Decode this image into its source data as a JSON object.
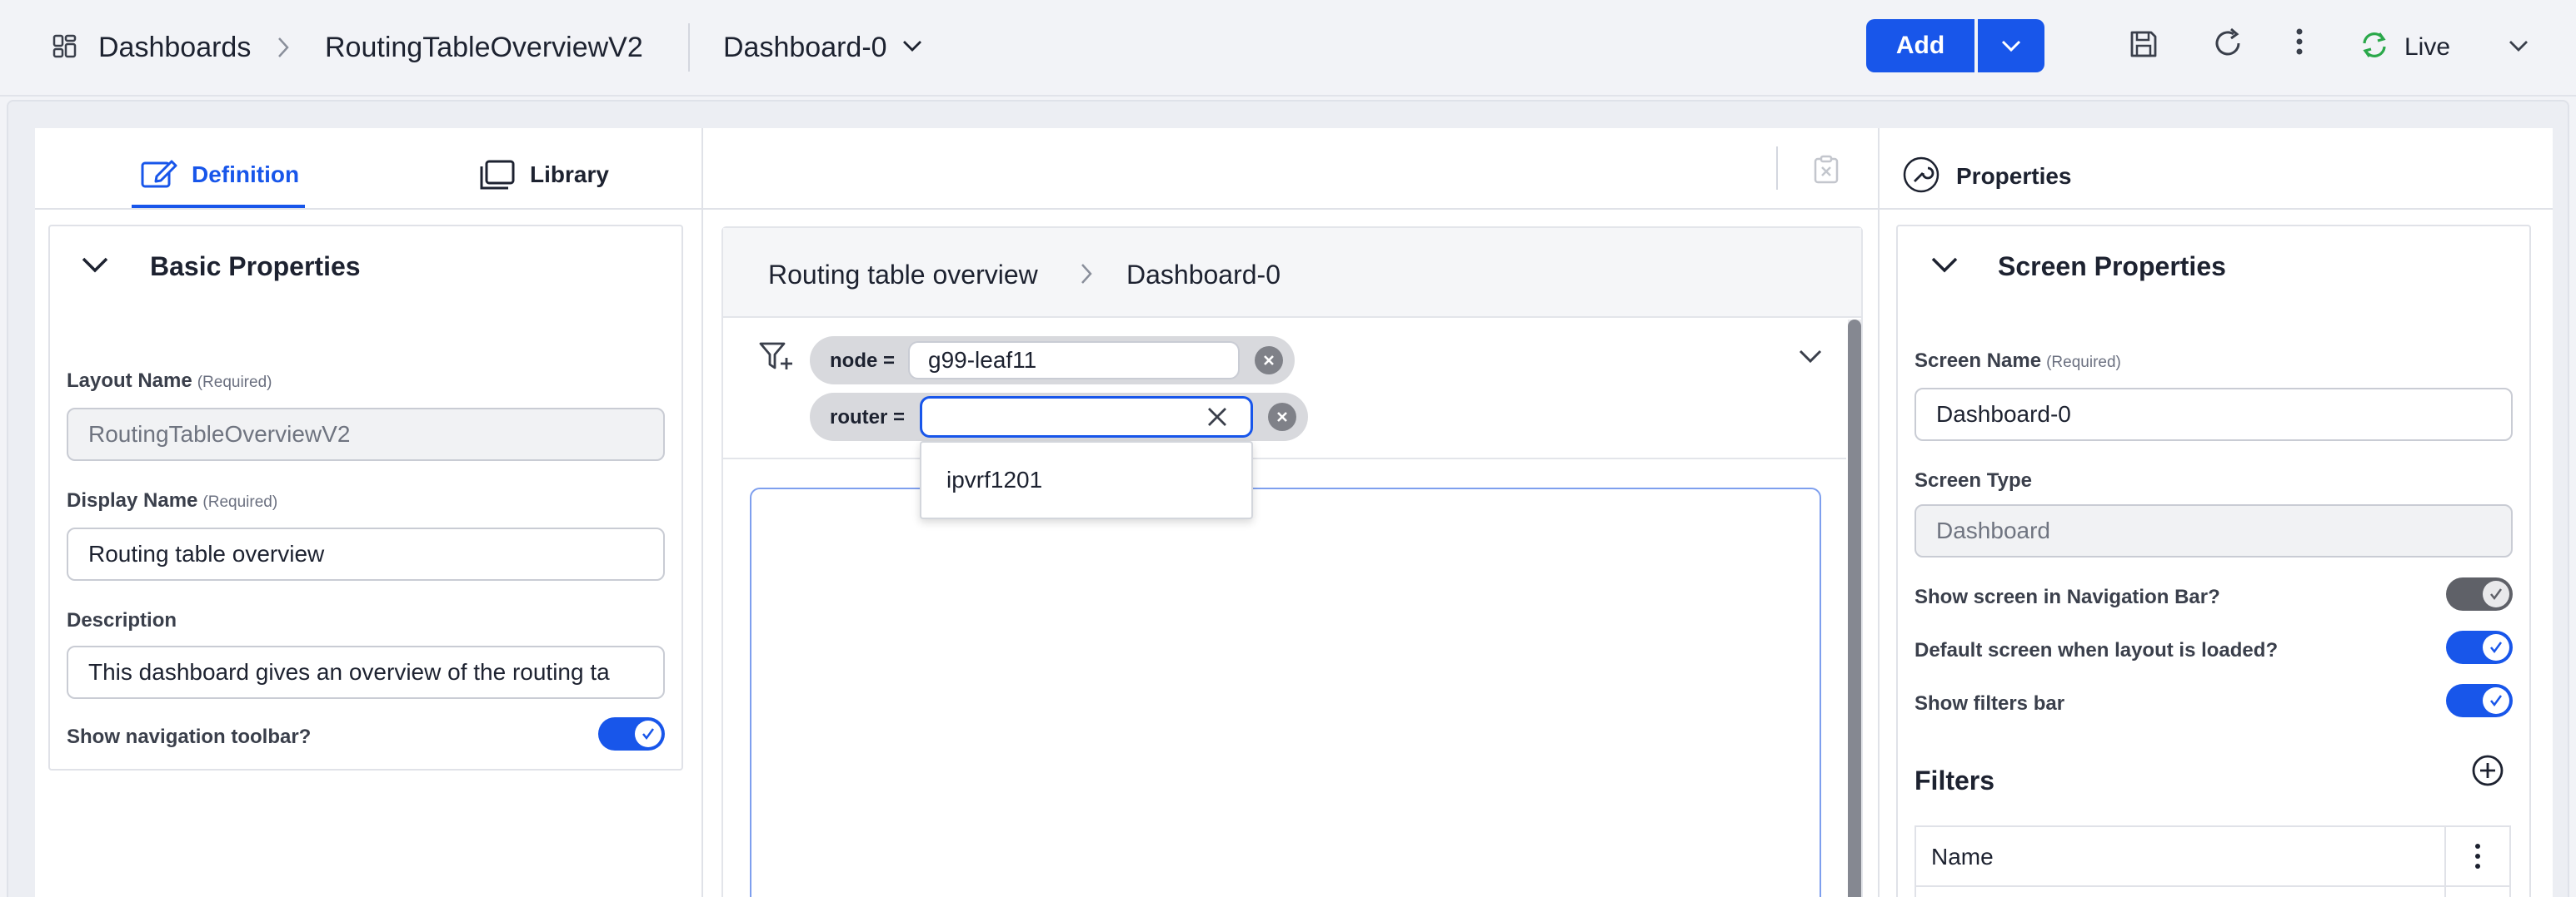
{
  "topbar": {
    "breadcrumb_root": "Dashboards",
    "breadcrumb_layout": "RoutingTableOverviewV2",
    "dashboard_selector": "Dashboard-0",
    "add_label": "Add",
    "live_label": "Live"
  },
  "left": {
    "tab_definition": "Definition",
    "tab_library": "Library",
    "section_title": "Basic Properties",
    "layout_name_label": "Layout Name",
    "layout_name_req": "(Required)",
    "layout_name_value": "RoutingTableOverviewV2",
    "display_name_label": "Display Name",
    "display_name_req": "(Required)",
    "display_name_value": "Routing table overview",
    "description_label": "Description",
    "description_value": "This dashboard gives an overview of the routing ta",
    "show_nav_toolbar_label": "Show navigation toolbar?",
    "show_nav_toolbar_on": true
  },
  "center": {
    "breadcrumb_layout": "Routing table overview",
    "breadcrumb_screen": "Dashboard-0",
    "filter_node_label": "node =",
    "filter_node_value": "g99-leaf11",
    "filter_router_label": "router =",
    "filter_router_value": "",
    "dropdown_option": "ipvrf1201"
  },
  "right": {
    "panel_title": "Properties",
    "section_title": "Screen Properties",
    "screen_name_label": "Screen Name",
    "screen_name_req": "(Required)",
    "screen_name_value": "Dashboard-0",
    "screen_type_label": "Screen Type",
    "screen_type_value": "Dashboard",
    "show_in_nav_label": "Show screen in Navigation Bar?",
    "default_screen_label": "Default screen when layout is loaded?",
    "show_filters_label": "Show filters bar",
    "filters_title": "Filters",
    "filters_col_name": "Name"
  },
  "colors": {
    "accent": "#1856ea",
    "live_icon": "#2aa84a",
    "toggle_disabled": "#5f6168"
  }
}
